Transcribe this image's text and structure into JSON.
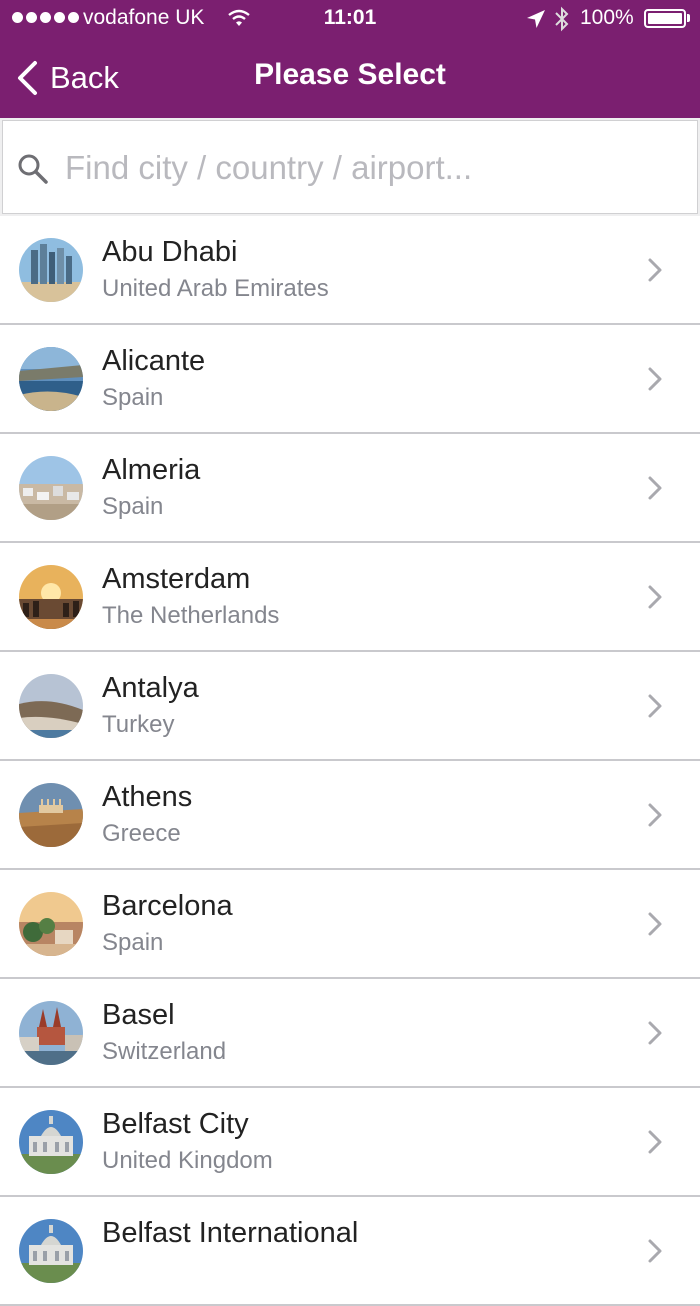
{
  "status_bar": {
    "carrier": "vodafone UK",
    "time": "11:01",
    "battery_percent": "100%",
    "battery_level": 1.0,
    "signal_bars": 5
  },
  "nav": {
    "back_label": "Back",
    "title": "Please Select"
  },
  "search": {
    "placeholder": "Find city / country / airport...",
    "value": ""
  },
  "colors": {
    "header_bg": "#7b1f70",
    "subtitle_text": "#84868e",
    "divider": "#c9c9cd"
  },
  "destinations": [
    {
      "city": "Abu Dhabi",
      "country": "United Arab Emirates",
      "thumb_icon": "abu-dhabi-skyline-thumbnail"
    },
    {
      "city": "Alicante",
      "country": "Spain",
      "thumb_icon": "alicante-coast-thumbnail"
    },
    {
      "city": "Almeria",
      "country": "Spain",
      "thumb_icon": "almeria-town-thumbnail"
    },
    {
      "city": "Amsterdam",
      "country": "The Netherlands",
      "thumb_icon": "amsterdam-canal-thumbnail"
    },
    {
      "city": "Antalya",
      "country": "Turkey",
      "thumb_icon": "antalya-cliffs-thumbnail"
    },
    {
      "city": "Athens",
      "country": "Greece",
      "thumb_icon": "athens-acropolis-thumbnail"
    },
    {
      "city": "Barcelona",
      "country": "Spain",
      "thumb_icon": "barcelona-park-thumbnail"
    },
    {
      "city": "Basel",
      "country": "Switzerland",
      "thumb_icon": "basel-cathedral-thumbnail"
    },
    {
      "city": "Belfast City",
      "country": "United Kingdom",
      "thumb_icon": "belfast-city-hall-thumbnail"
    },
    {
      "city": "Belfast International",
      "country": "",
      "thumb_icon": "belfast-city-hall-thumbnail"
    }
  ]
}
